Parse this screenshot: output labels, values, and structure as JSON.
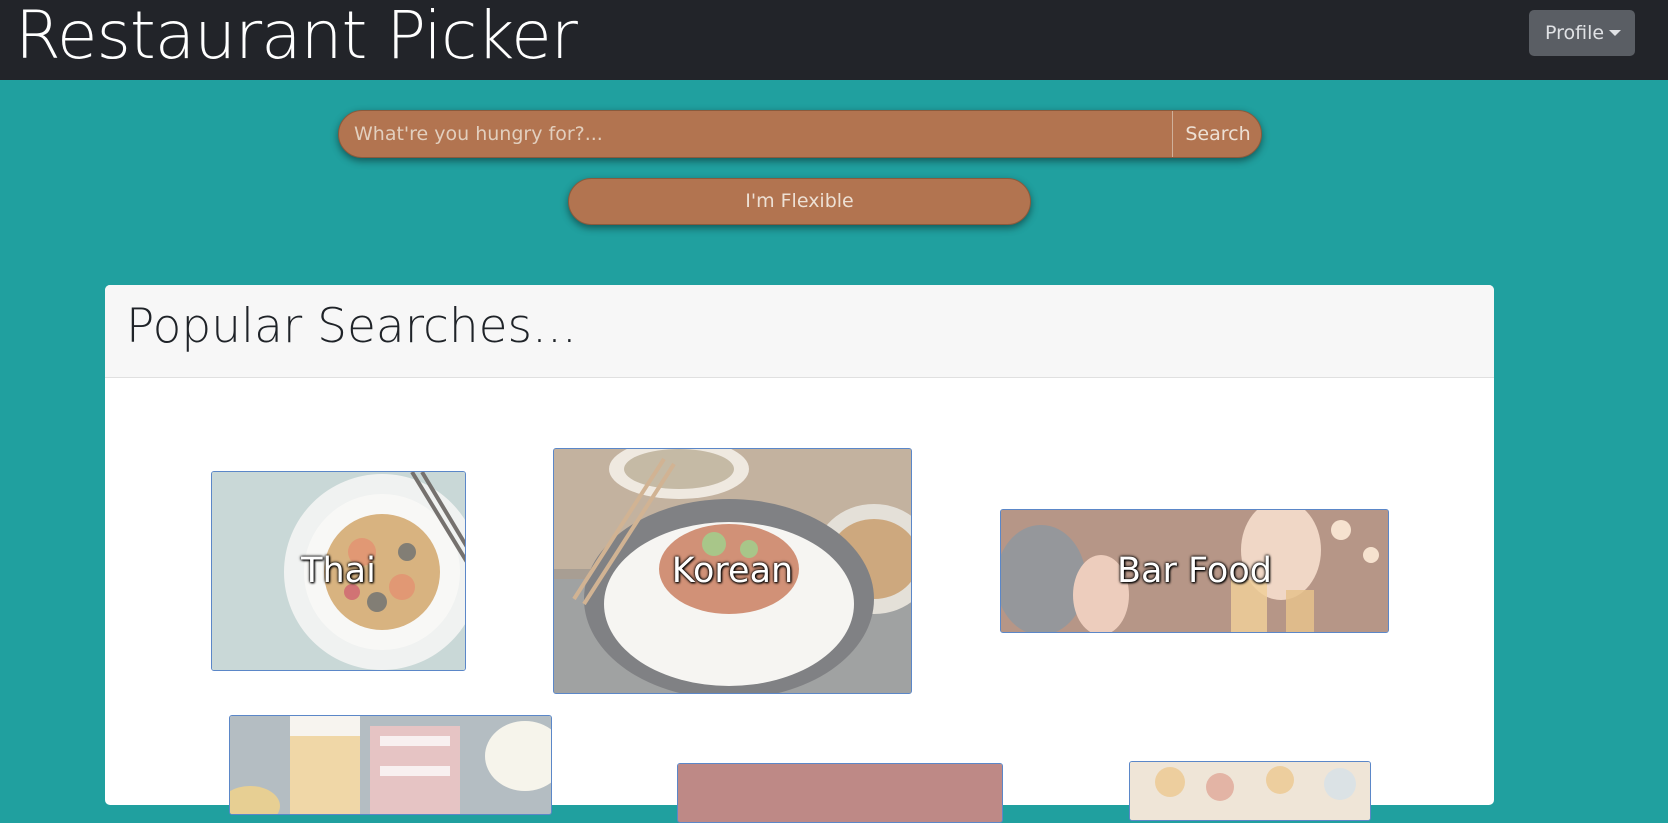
{
  "navbar": {
    "brand": "Restaurant Picker",
    "profile_label": "Profile"
  },
  "search": {
    "placeholder": "What're you hungry for?...",
    "button_label": "Search"
  },
  "flexible_button": "I'm Flexible",
  "popular": {
    "title": "Popular Searches...",
    "tiles": [
      {
        "label": "Thai"
      },
      {
        "label": "Korean"
      },
      {
        "label": "Bar Food"
      },
      {
        "label": ""
      },
      {
        "label": ""
      },
      {
        "label": ""
      }
    ]
  },
  "colors": {
    "navbar": "#222429",
    "background": "#20a09f",
    "accent": "#b27450",
    "tile_border": "#5b87c8"
  }
}
